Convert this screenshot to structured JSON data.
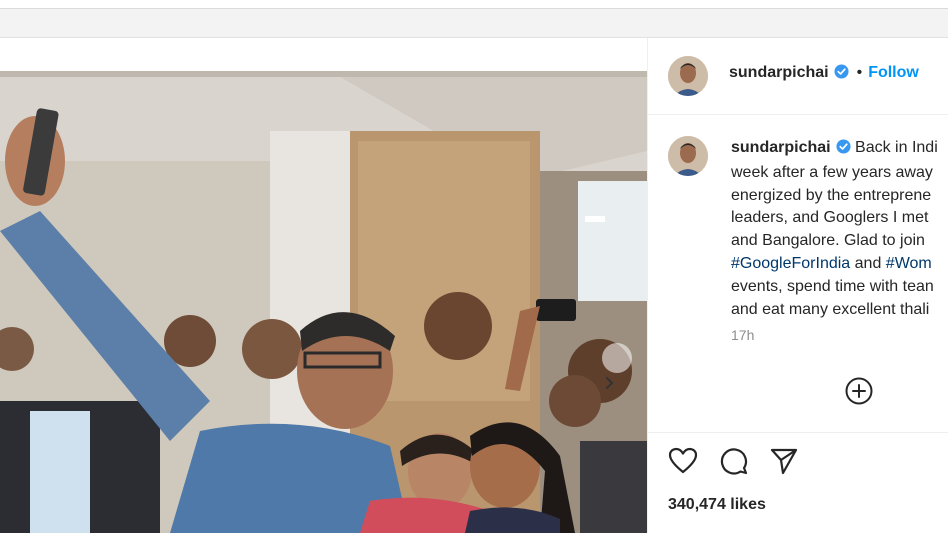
{
  "post": {
    "username": "sundarpichai",
    "follow_label": "Follow",
    "separator": "•",
    "caption": {
      "line1": "Back in Indi",
      "line2": "week after a few years away",
      "line3": "energized by the entreprene",
      "line4": "leaders, and Googlers I met",
      "line5": "and Bangalore. Glad to join",
      "tag1": "#GoogleForIndia",
      "and": "and",
      "tag2": "#Wom",
      "line7": "events, spend time with tean",
      "line8": "and eat many excellent thali"
    },
    "time": "17h",
    "likes": "340,474 likes"
  },
  "colors": {
    "accent": "#0095f6",
    "hashtag": "#00376b",
    "verified": "#3897f0",
    "muted": "#8e8e8e"
  },
  "icons": [
    "verified-badge-icon",
    "chevron-right-icon",
    "plus-circle-icon",
    "heart-icon",
    "comment-icon",
    "share-icon"
  ]
}
